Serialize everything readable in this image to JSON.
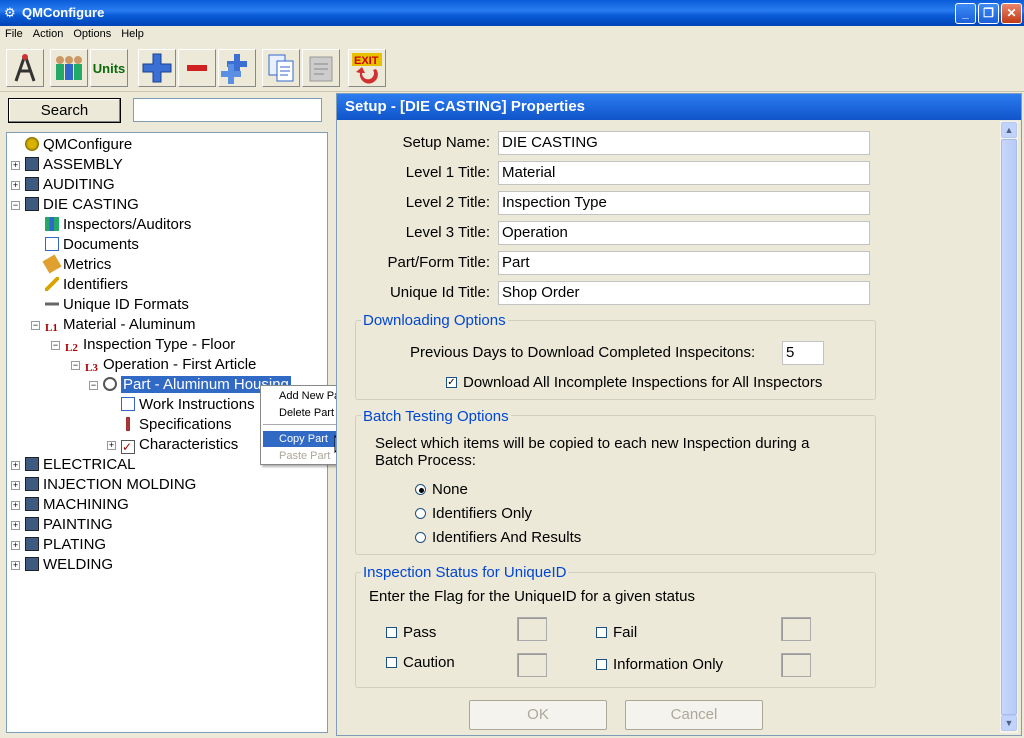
{
  "window": {
    "title": "QMConfigure",
    "minimize": "_",
    "restore": "❐",
    "close": "✕"
  },
  "menu": [
    "File",
    "Action",
    "Options",
    "Help"
  ],
  "toolbar": {
    "units_label": "Units",
    "exit_label": "EXIT"
  },
  "search": {
    "button": "Search",
    "value": ""
  },
  "tree": {
    "root": "QMConfigure",
    "assembly": "ASSEMBLY",
    "auditing": "AUDITING",
    "diecasting": "DIE CASTING",
    "inspectors": "Inspectors/Auditors",
    "documents": "Documents",
    "metrics": "Metrics",
    "identifiers": "Identifiers",
    "uniqueid": "Unique ID Formats",
    "material": "Material - Aluminum",
    "insptype": "Inspection Type - Floor",
    "operation": "Operation - First Article",
    "part": "Part - Aluminum Housing",
    "workinst": "Work Instructions",
    "specs": "Specifications",
    "chars": "Characteristics",
    "electrical": "ELECTRICAL",
    "injection": "INJECTION MOLDING",
    "machining": "MACHINING",
    "painting": "PAINTING",
    "plating": "PLATING",
    "welding": "WELDING"
  },
  "context_menu": {
    "add": "Add New Part",
    "delete": "Delete Part",
    "copy": "Copy Part",
    "paste": "Paste Part"
  },
  "panel": {
    "title": "Setup - [DIE CASTING] Properties",
    "fields": [
      {
        "label": "Setup Name:",
        "value": "DIE CASTING"
      },
      {
        "label": "Level 1 Title:",
        "value": "Material"
      },
      {
        "label": "Level 2 Title:",
        "value": "Inspection Type"
      },
      {
        "label": "Level 3 Title:",
        "value": "Operation"
      },
      {
        "label": "Part/Form Title:",
        "value": "Part"
      },
      {
        "label": "Unique Id Title:",
        "value": "Shop Order"
      }
    ],
    "downloading": {
      "title": "Downloading Options",
      "days_label": "Previous Days to Download Completed Inspecitons:",
      "days_value": "5",
      "download_all": "Download All Incomplete Inspections for All Inspectors",
      "download_all_checked": true
    },
    "batch": {
      "title": "Batch Testing Options",
      "desc1": "Select which items will be copied to each new Inspection during a",
      "desc2": "Batch Process:",
      "options": [
        "None",
        "Identifiers Only",
        "Identifiers And Results"
      ],
      "selected": "None"
    },
    "status": {
      "title": "Inspection Status for UniqueID",
      "desc": "Enter the Flag for the UniqueID for a given status",
      "pass": "Pass",
      "fail": "Fail",
      "caution": "Caution",
      "info": "Information Only"
    },
    "ok": "OK",
    "cancel": "Cancel"
  }
}
